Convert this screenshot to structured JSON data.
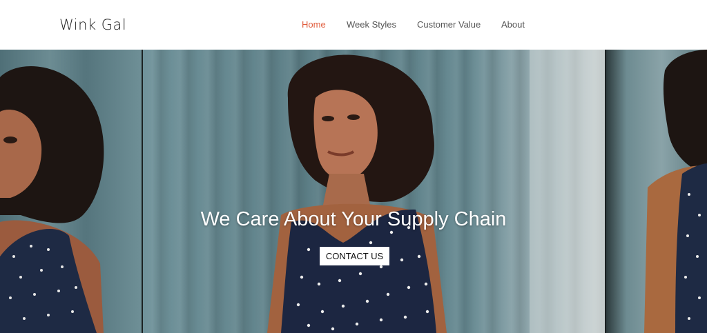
{
  "header": {
    "logo": "Wink Gal",
    "nav": [
      {
        "label": "Home",
        "active": true
      },
      {
        "label": "Week Styles",
        "active": false
      },
      {
        "label": "Customer Value",
        "active": false
      },
      {
        "label": "About",
        "active": false
      }
    ]
  },
  "hero": {
    "title": "We Care About Your Supply Chain",
    "cta_label": "CONTACT US"
  },
  "colors": {
    "accent": "#e05a3a",
    "nav_text": "#555555",
    "hero_text": "#ffffff"
  }
}
